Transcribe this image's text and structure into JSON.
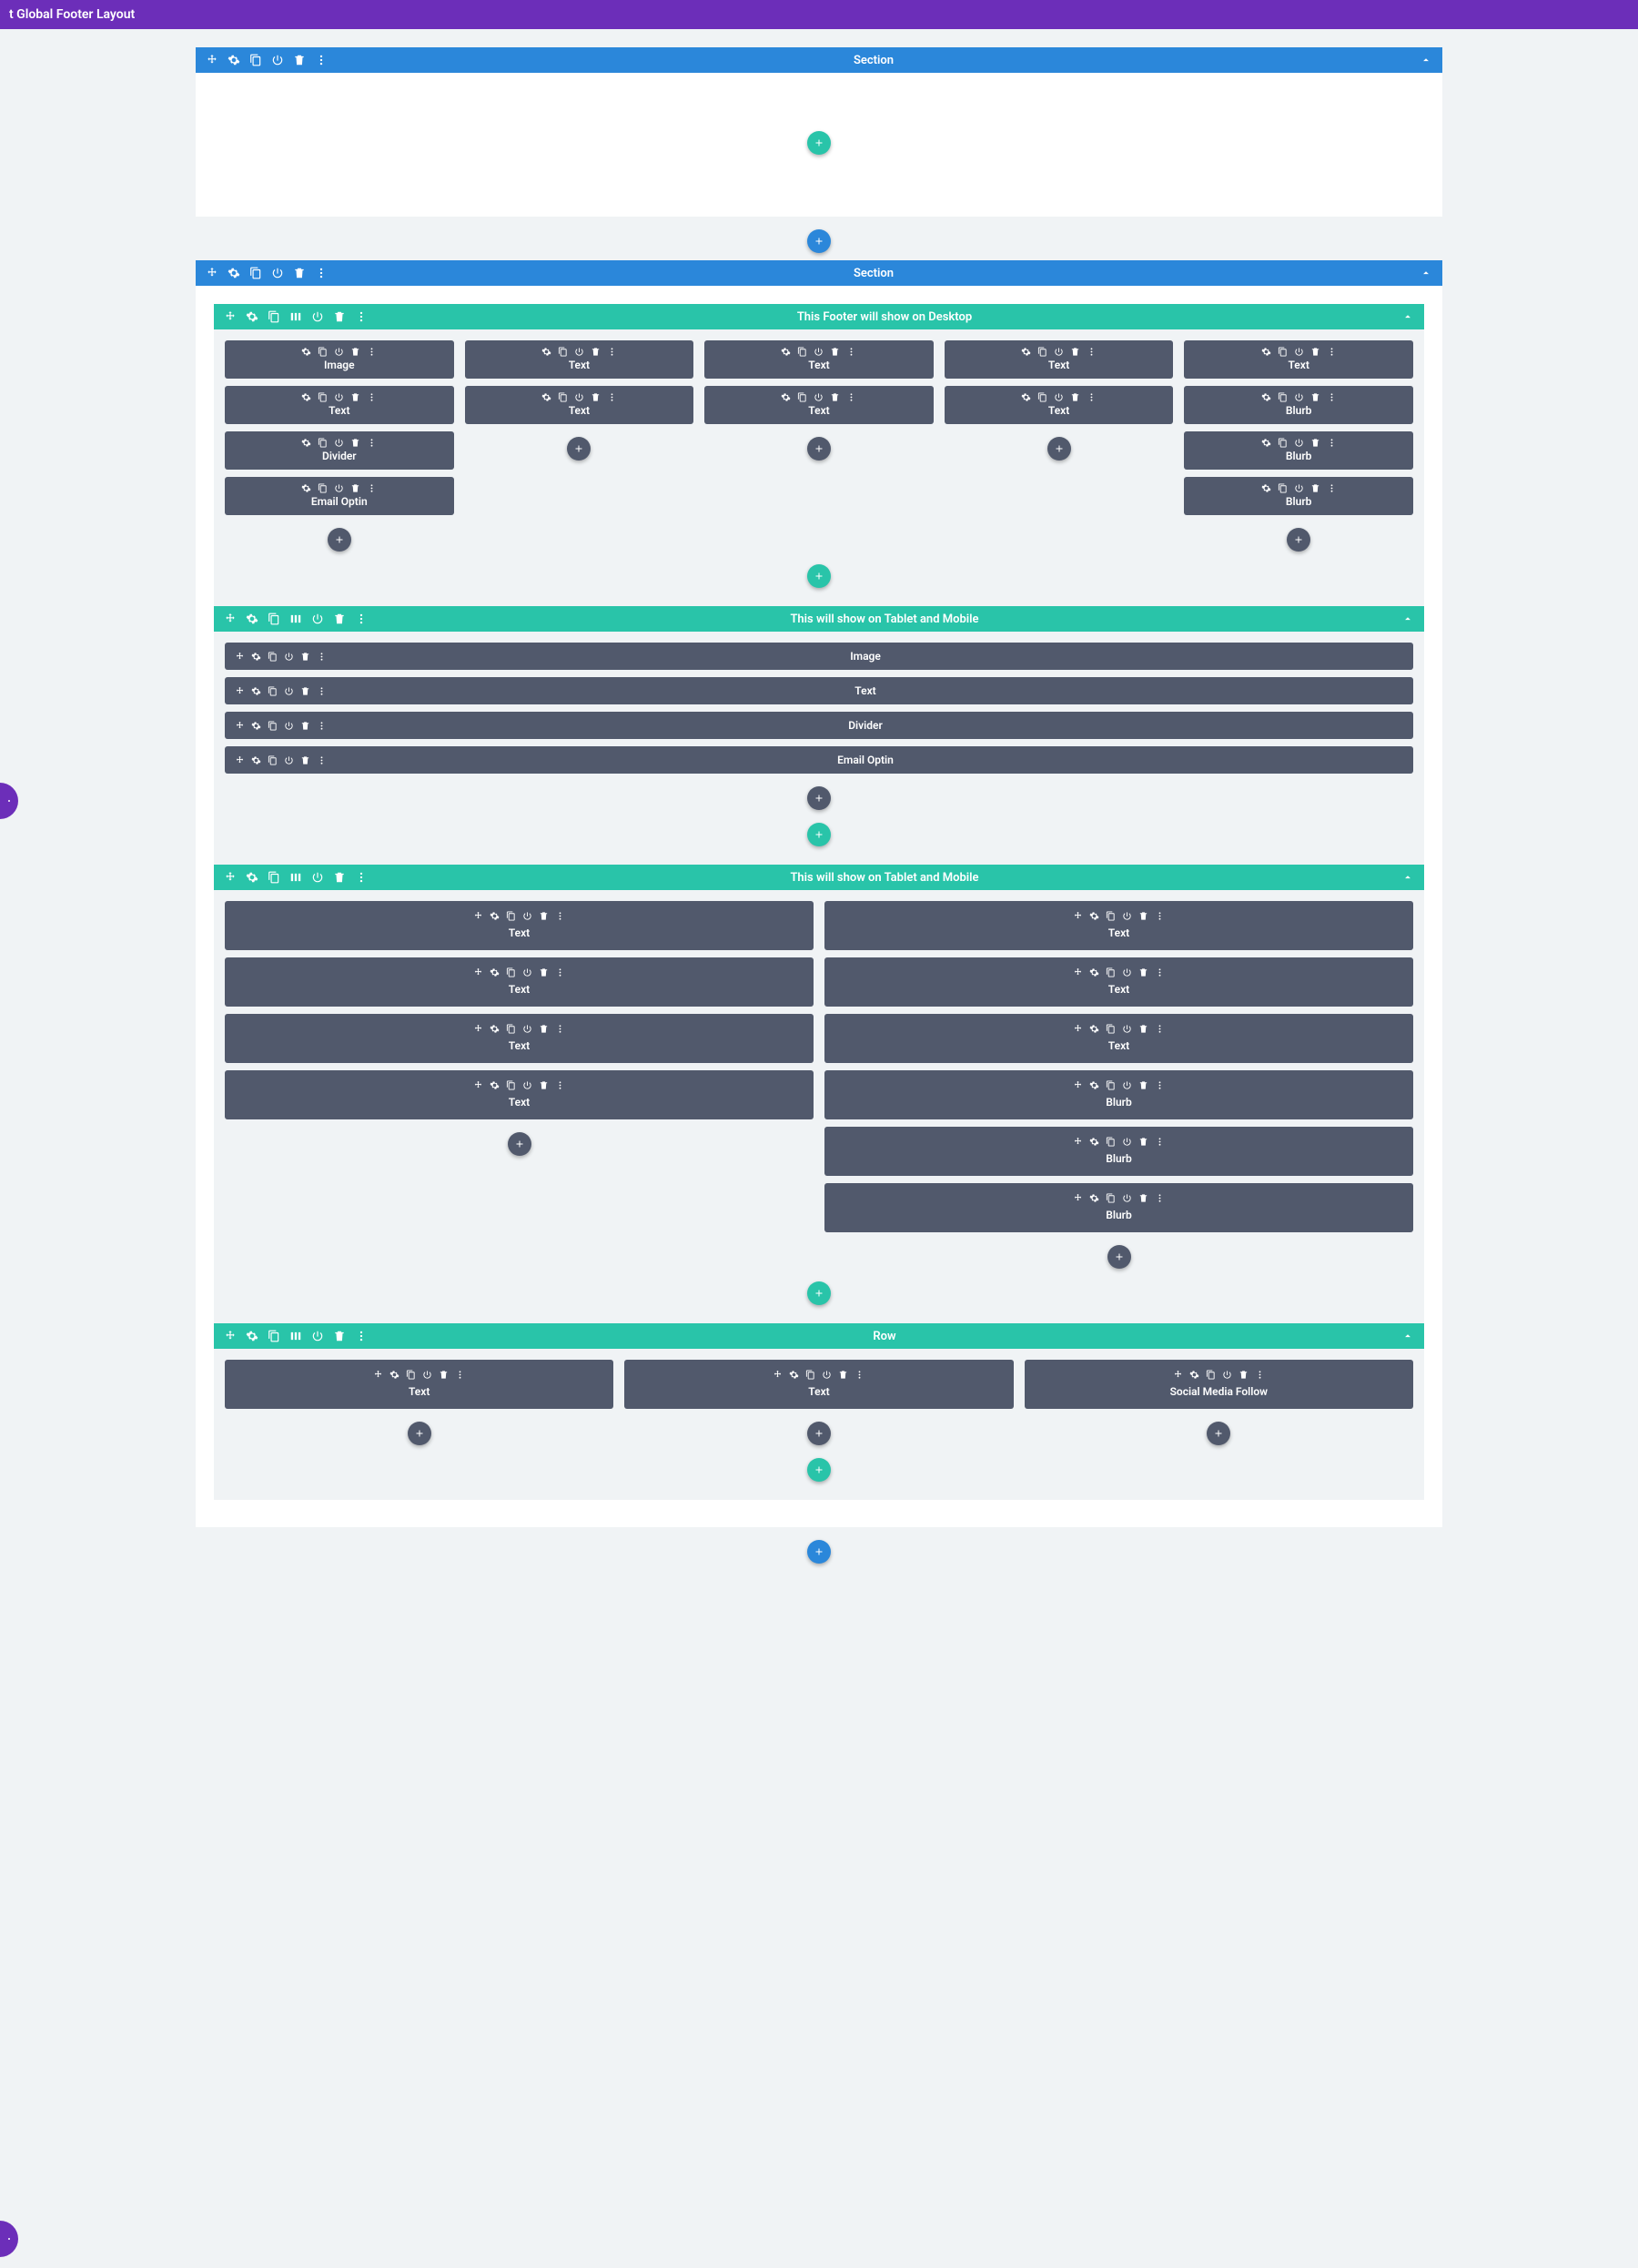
{
  "topbar": {
    "title": "t Global Footer Layout"
  },
  "sections": [
    {
      "label": "Section",
      "rows": []
    },
    {
      "label": "Section",
      "rows": [
        {
          "label": "This Footer will show on Desktop",
          "layout": "5col",
          "columns": [
            [
              "Image",
              "Text",
              "Divider",
              "Email Optin"
            ],
            [
              "Text",
              "Text"
            ],
            [
              "Text",
              "Text"
            ],
            [
              "Text",
              "Text"
            ],
            [
              "Text",
              "Blurb",
              "Blurb",
              "Blurb"
            ]
          ]
        },
        {
          "label": "This will show on Tablet and Mobile",
          "layout": "1col-full",
          "columns": [
            [
              "Image",
              "Text",
              "Divider",
              "Email Optin"
            ]
          ]
        },
        {
          "label": "This will show on Tablet and Mobile",
          "layout": "2col-tall",
          "columns": [
            [
              "Text",
              "Text",
              "Text",
              "Text"
            ],
            [
              "Text",
              "Text",
              "Text",
              "Blurb",
              "Blurb",
              "Blurb"
            ]
          ]
        },
        {
          "label": "Row",
          "layout": "3col",
          "columns": [
            [
              "Text"
            ],
            [
              "Text"
            ],
            [
              "Social Media Follow"
            ]
          ]
        }
      ]
    }
  ],
  "icons": {
    "move": "move-icon",
    "settings": "gear-icon",
    "duplicate": "duplicate-icon",
    "columns": "columns-icon",
    "power": "power-icon",
    "trash": "trash-icon",
    "more": "dots-icon",
    "collapse": "chevron-up-icon",
    "plus": "plus-icon"
  }
}
